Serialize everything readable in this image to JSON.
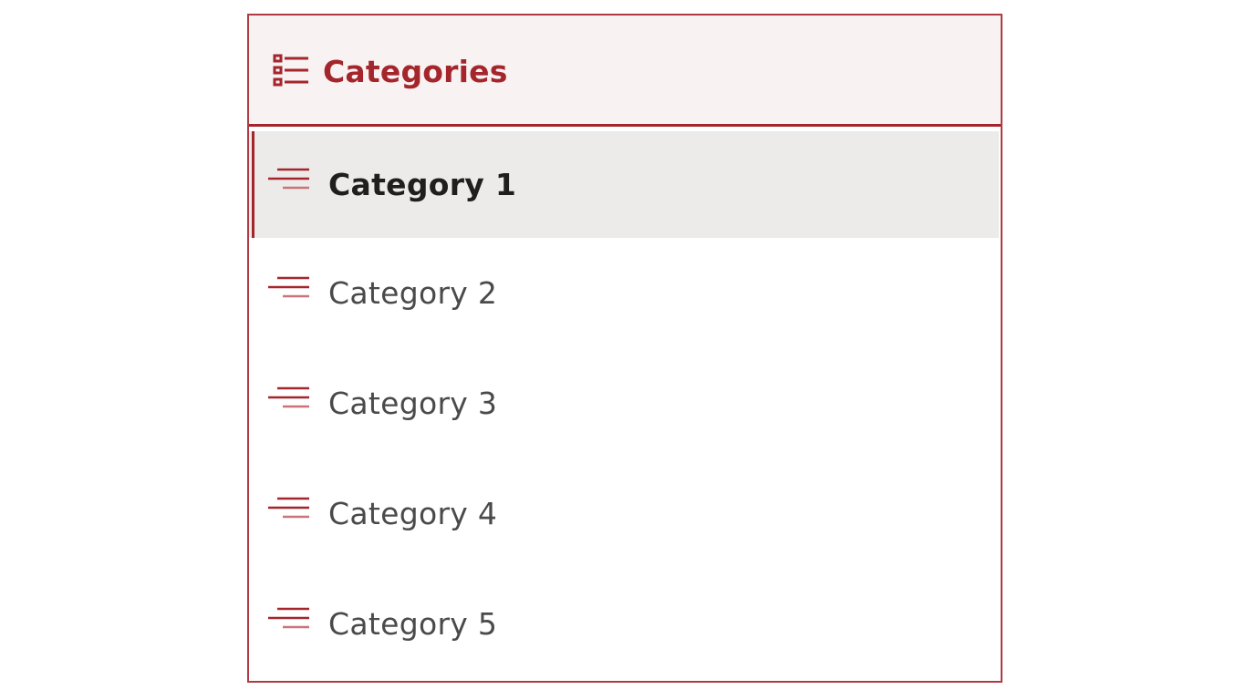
{
  "accent_color": "#a4262c",
  "header": {
    "icon": "category-list-icon",
    "title": "Categories"
  },
  "list": {
    "selected_index": 0,
    "items": [
      {
        "label": "Category 1",
        "icon": "lines-icon"
      },
      {
        "label": "Category 2",
        "icon": "lines-icon"
      },
      {
        "label": "Category 3",
        "icon": "lines-icon"
      },
      {
        "label": "Category 4",
        "icon": "lines-icon"
      },
      {
        "label": "Category 5",
        "icon": "lines-icon"
      }
    ]
  }
}
